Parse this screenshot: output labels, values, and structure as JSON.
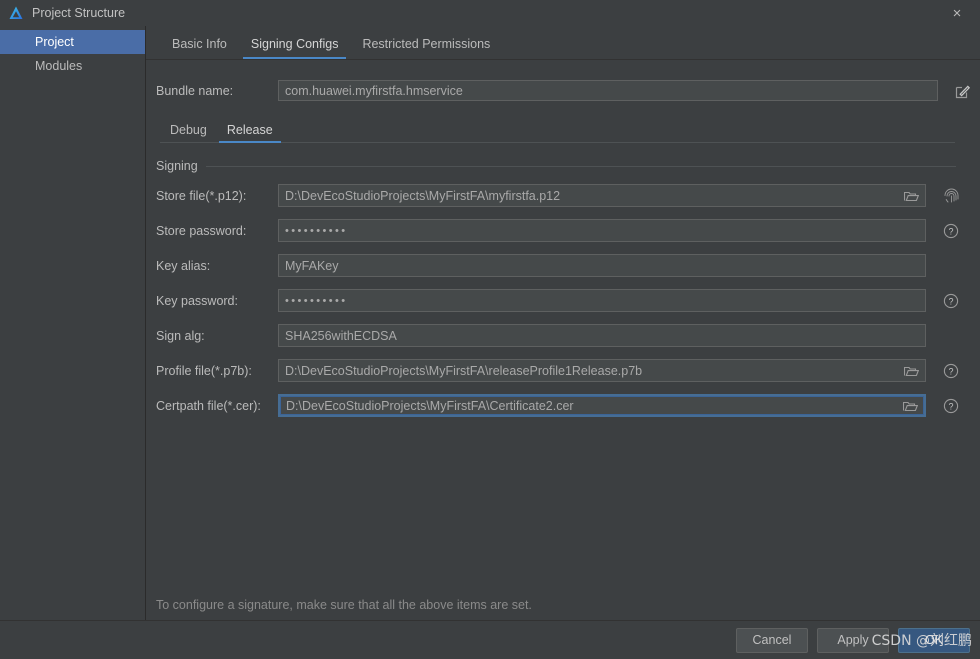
{
  "window": {
    "title": "Project Structure",
    "app_icon": "deveco-logo-icon",
    "close_label": "×"
  },
  "sidebar": {
    "items": [
      {
        "label": "Project",
        "selected": true
      },
      {
        "label": "Modules",
        "selected": false
      }
    ]
  },
  "top_tabs": [
    {
      "label": "Basic Info",
      "active": false
    },
    {
      "label": "Signing Configs",
      "active": true
    },
    {
      "label": "Restricted Permissions",
      "active": false
    }
  ],
  "bundle": {
    "label": "Bundle name:",
    "value": "com.huawei.myfirstfa.hmservice",
    "edit_icon": "edit-pencil-icon"
  },
  "sub_tabs": [
    {
      "label": "Debug",
      "active": false
    },
    {
      "label": "Release",
      "active": true
    }
  ],
  "group": {
    "title": "Signing"
  },
  "fields": [
    {
      "label": "Store file(*.p12):",
      "value": "D:\\DevEcoStudioProjects\\MyFirstFA\\myfirstfa.p12",
      "type": "text",
      "browse": true,
      "aux": "fingerprint-icon",
      "focused": false
    },
    {
      "label": "Store password:",
      "value": "••••••••••",
      "type": "password",
      "browse": false,
      "aux": "help-icon",
      "focused": false
    },
    {
      "label": "Key alias:",
      "value": "MyFAKey",
      "type": "text",
      "browse": false,
      "aux": "none",
      "focused": false
    },
    {
      "label": "Key password:",
      "value": "••••••••••",
      "type": "password",
      "browse": false,
      "aux": "help-icon",
      "focused": false
    },
    {
      "label": "Sign alg:",
      "value": "SHA256withECDSA",
      "type": "text",
      "browse": false,
      "aux": "none",
      "focused": false
    },
    {
      "label": "Profile file(*.p7b):",
      "value": "D:\\DevEcoStudioProjects\\MyFirstFA\\releaseProfile1Release.p7b",
      "type": "text",
      "browse": true,
      "aux": "help-icon",
      "focused": false
    },
    {
      "label": "Certpath file(*.cer):",
      "value": "D:\\DevEcoStudioProjects\\MyFirstFA\\Certificate2.cer",
      "type": "text",
      "browse": true,
      "aux": "help-icon",
      "focused": true
    }
  ],
  "hint": "To configure a signature, make sure that all the above items are set.",
  "footer": {
    "cancel_label": "Cancel",
    "apply_label": "Apply",
    "ok_label": "OK"
  },
  "watermark": {
    "text": "CSDN @刘红鹏"
  },
  "colors": {
    "background": "#3c3f41",
    "field_bg": "#45494a",
    "accent_blue": "#4a88c7",
    "selection_blue": "#4a6da7",
    "primary_button": "#365880",
    "focus_border": "#466d94"
  }
}
